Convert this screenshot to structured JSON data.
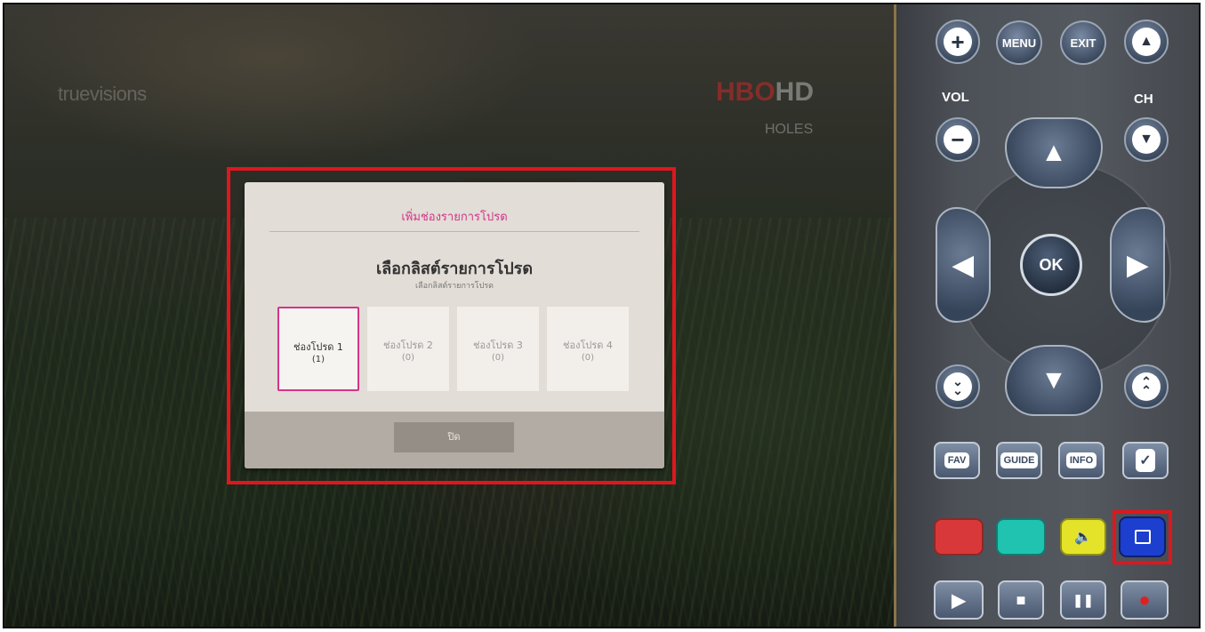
{
  "tv": {
    "channel_logo_left": "truevisions",
    "channel_logo_right_red": "HBO",
    "channel_logo_right": "HD",
    "channel_logo_sub": "HOLES"
  },
  "dialog": {
    "title": "เพิ่มช่องรายการโปรด",
    "heading": "เลือกลิสต์รายการโปรด",
    "subheading": "เลือกลิสต์รายการโปรด",
    "lists": [
      {
        "name": "ช่องโปรด 1",
        "count": "(1)",
        "selected": true
      },
      {
        "name": "ช่องโปรด 2",
        "count": "(0)",
        "selected": false
      },
      {
        "name": "ช่องโปรด 3",
        "count": "(0)",
        "selected": false
      },
      {
        "name": "ช่องโปรด 4",
        "count": "(0)",
        "selected": false
      }
    ],
    "close_label": "ปิด",
    "accent_color": "#d5348b"
  },
  "remote": {
    "vol_up_icon": "plus-icon",
    "menu_label": "MENU",
    "exit_label": "EXIT",
    "ch_up_icon": "triangle-up-icon",
    "vol_label": "VOL",
    "ch_label": "CH",
    "vol_down_icon": "minus-icon",
    "ch_down_icon": "triangle-down-icon",
    "ok_label": "OK",
    "up_arrow": "▲",
    "down_arrow": "▼",
    "left_arrow": "◀",
    "right_arrow": "▶",
    "page_down_icon": "double-chevron-down-icon",
    "page_up_icon": "double-chevron-up-icon",
    "fav_label": "FAV",
    "guide_label": "GUIDE",
    "info_label": "INFO",
    "check_label": "✓",
    "color_buttons": [
      {
        "name": "red-button",
        "color": "#d9383a",
        "label": ""
      },
      {
        "name": "green-button",
        "color": "#20c3b0",
        "label": ""
      },
      {
        "name": "yellow-button",
        "color": "#e4e32a",
        "label": "🔈"
      },
      {
        "name": "blue-button",
        "color": "#1c3fd0",
        "label": ""
      }
    ],
    "play_label": "▶",
    "stop_label": "■",
    "pause_label": "❚❚",
    "record_label": "●"
  }
}
